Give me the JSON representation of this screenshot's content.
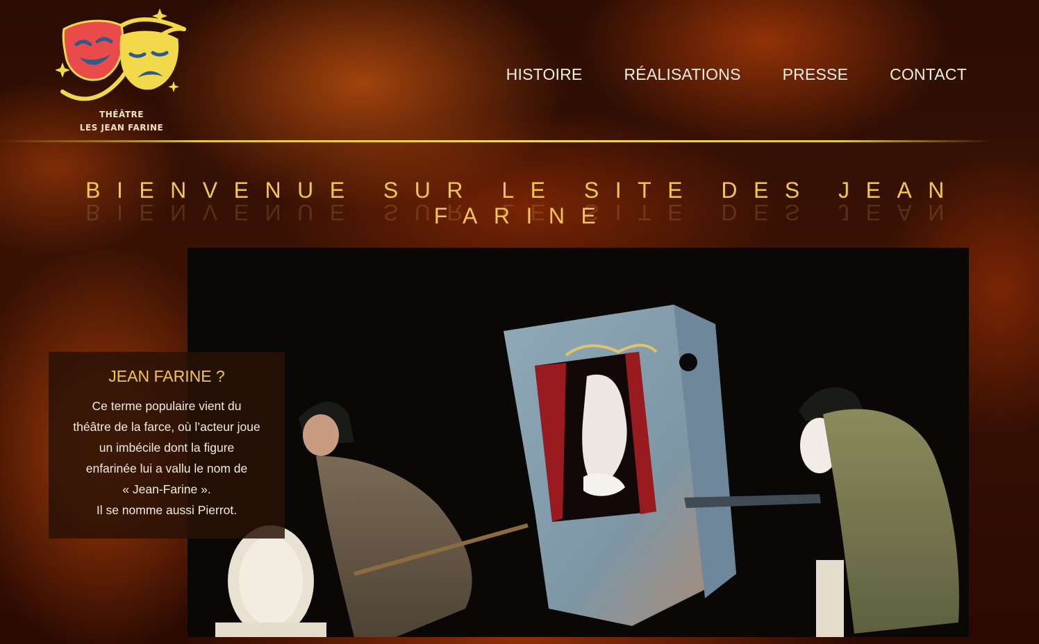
{
  "logo": {
    "line1": "THÉÂTRE",
    "line2": "LES JEAN FARINE",
    "colors": {
      "comedy_mask": "#e94b4b",
      "tragedy_mask": "#f2d94a",
      "ribbon": "#f2d94a",
      "mask_features": "#2f5a8a"
    }
  },
  "nav": {
    "items": [
      {
        "label": "HISTOIRE"
      },
      {
        "label": "RÉALISATIONS"
      },
      {
        "label": "PRESSE"
      },
      {
        "label": "CONTACT"
      }
    ]
  },
  "hero": {
    "title": "BIENVENUE SUR LE SITE DES JEAN FARINE"
  },
  "info_card": {
    "heading": "JEAN FARINE ?",
    "lines": [
      "Ce terme populaire vient du",
      "théâtre de la farce, où l’acteur joue",
      "un imbécile dont la figure",
      "enfarinée lui a vallu le nom de",
      "« Jean-Farine ».",
      "Il se nomme aussi Pierrot."
    ]
  },
  "theme_colors": {
    "accent_gold": "#f1c752",
    "background": "#2a0c03",
    "flame": "#e8640f"
  }
}
